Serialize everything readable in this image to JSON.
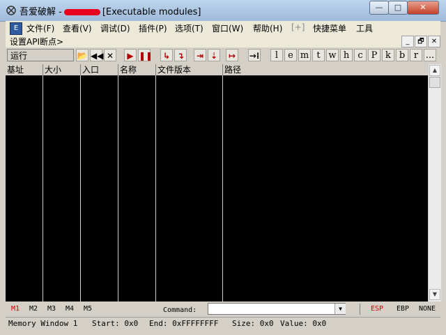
{
  "window": {
    "title_prefix": "吾爱破解 -",
    "title_suffix": "[Executable modules]",
    "min_glyph": "—",
    "max_glyph": "□",
    "close_glyph": "✕"
  },
  "menu": {
    "items": [
      "文件(F)",
      "查看(V)",
      "调试(D)",
      "插件(P)",
      "选项(T)",
      "窗口(W)",
      "帮助(H)",
      "[+]",
      "快捷菜单",
      "工具"
    ]
  },
  "submenu": {
    "label": "设置API断点>",
    "buttons": [
      "_",
      "🗗",
      "✕"
    ]
  },
  "toolbar": {
    "status": "运行",
    "buttons": [
      "📂",
      "◀◀",
      "✕",
      "▶",
      "❚❚",
      "↳",
      "↴",
      "⇥",
      "⇣",
      "↦",
      "→⁞"
    ],
    "letters": [
      "l",
      "e",
      "m",
      "t",
      "w",
      "h",
      "c",
      "P",
      "k",
      "b",
      "r",
      "..."
    ]
  },
  "table": {
    "columns": [
      "基址",
      "大小",
      "入口",
      "名称",
      "文件版本",
      "路径"
    ],
    "rows": []
  },
  "scroll": {
    "up": "▲",
    "down": "▼"
  },
  "command_bar": {
    "markers": [
      "M1",
      "M2",
      "M3",
      "M4",
      "M5"
    ],
    "command_label": "Command:",
    "command_value": "",
    "dropdown_glyph": "▼",
    "registers": [
      "ESP",
      "EBP",
      "NONE"
    ]
  },
  "status": {
    "memory_window": "Memory Window 1",
    "start": "Start: 0x0",
    "end": "End: 0xFFFFFFFF",
    "size": "Size: 0x0",
    "value": "Value: 0x0"
  },
  "colors": {
    "active_marker": "#cc0000",
    "active_register": "#cc0000",
    "grid_background": "#000000"
  }
}
